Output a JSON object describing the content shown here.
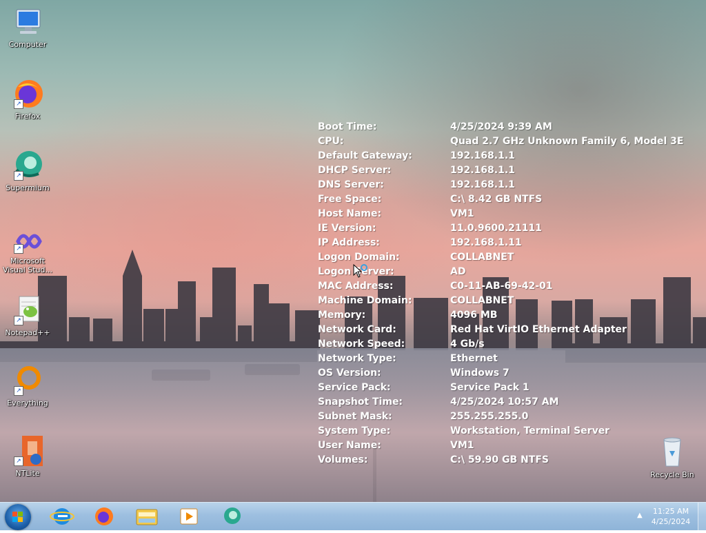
{
  "desktop_icons": [
    {
      "label": "Computer",
      "icon": "computer-icon"
    },
    {
      "label": "Firefox",
      "icon": "firefox-icon"
    },
    {
      "label": "Supermium",
      "icon": "supermium-icon"
    },
    {
      "label": "Microsoft Visual Stud...",
      "icon": "visual-studio-icon"
    },
    {
      "label": "Notepad++",
      "icon": "notepadpp-icon"
    },
    {
      "label": "Everything",
      "icon": "everything-icon"
    },
    {
      "label": "NTLite",
      "icon": "ntlite-icon"
    },
    {
      "label": "Recycle Bin",
      "icon": "recycle-bin-icon"
    }
  ],
  "sysinfo": [
    {
      "label": "Boot Time:",
      "value": "4/25/2024 9:39 AM"
    },
    {
      "label": "CPU:",
      "value": "Quad 2.7 GHz Unknown Family 6, Model 3E"
    },
    {
      "label": "Default Gateway:",
      "value": "192.168.1.1"
    },
    {
      "label": "DHCP Server:",
      "value": "192.168.1.1"
    },
    {
      "label": "DNS Server:",
      "value": "192.168.1.1"
    },
    {
      "label": "Free Space:",
      "value": "C:\\ 8.42 GB NTFS"
    },
    {
      "label": "Host Name:",
      "value": "VM1"
    },
    {
      "label": "IE Version:",
      "value": "11.0.9600.21111"
    },
    {
      "label": "IP Address:",
      "value": "192.168.1.11"
    },
    {
      "label": "Logon Domain:",
      "value": "COLLABNET"
    },
    {
      "label": "Logon Server:",
      "value": "AD"
    },
    {
      "label": "MAC Address:",
      "value": "C0-11-AB-69-42-01"
    },
    {
      "label": "Machine Domain:",
      "value": "COLLABNET"
    },
    {
      "label": "Memory:",
      "value": "4096 MB"
    },
    {
      "label": "Network Card:",
      "value": "Red Hat VirtIO Ethernet Adapter"
    },
    {
      "label": "Network Speed:",
      "value": "4 Gb/s"
    },
    {
      "label": "Network Type:",
      "value": "Ethernet"
    },
    {
      "label": "OS Version:",
      "value": "Windows 7"
    },
    {
      "label": "Service Pack:",
      "value": "Service Pack 1"
    },
    {
      "label": "Snapshot Time:",
      "value": "4/25/2024 10:57 AM"
    },
    {
      "label": "Subnet Mask:",
      "value": "255.255.255.0"
    },
    {
      "label": "System Type:",
      "value": "Workstation, Terminal Server"
    },
    {
      "label": "User Name:",
      "value": "VM1"
    },
    {
      "label": "Volumes:",
      "value": "C:\\ 59.90 GB NTFS"
    }
  ],
  "taskbar": {
    "pinned": [
      "start-orb",
      "internet-explorer-icon",
      "firefox-icon",
      "file-explorer-icon",
      "media-player-icon",
      "supermium-icon"
    ],
    "clock_time": "11:25 AM",
    "clock_date": "4/25/2024"
  }
}
